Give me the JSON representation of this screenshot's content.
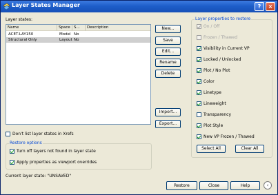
{
  "window": {
    "title": "Layer States Manager",
    "help_glyph": "?",
    "close_glyph": "×"
  },
  "layer_states": {
    "label": "Layer states:",
    "columns": [
      "Name",
      "Space",
      "S...",
      "Description"
    ],
    "rows": [
      {
        "name": "ACET-LAY150",
        "space": "Model",
        "same": "No",
        "description": ""
      },
      {
        "name": "Structural Only",
        "space": "Layout",
        "same": "No",
        "description": ""
      }
    ]
  },
  "buttons": {
    "new": "New...",
    "save": "Save",
    "edit": "Edit...",
    "rename": "Rename",
    "delete": "Delete",
    "import": "Import...",
    "export": "Export..."
  },
  "dont_list_xrefs": {
    "label": "Don't list layer states in Xrefs",
    "checked": false
  },
  "restore_options": {
    "title": "Restore options",
    "items": [
      {
        "label": "Turn off layers not found in layer state",
        "checked": true
      },
      {
        "label": "Apply properties as viewport overrides",
        "checked": true
      }
    ]
  },
  "properties": {
    "title": "Layer properties to restore",
    "items": [
      {
        "label": "On / Off",
        "checked": true,
        "enabled": false
      },
      {
        "label": "Frozen / Thawed",
        "checked": false,
        "enabled": false
      },
      {
        "label": "Visibility in Current VP",
        "checked": true,
        "enabled": true
      },
      {
        "label": "Locked / Unlocked",
        "checked": true,
        "enabled": true
      },
      {
        "label": "Plot / No Plot",
        "checked": true,
        "enabled": true
      },
      {
        "label": "Color",
        "checked": true,
        "enabled": true
      },
      {
        "label": "Linetype",
        "checked": true,
        "enabled": true
      },
      {
        "label": "Lineweight",
        "checked": true,
        "enabled": true
      },
      {
        "label": "Transparency",
        "checked": false,
        "enabled": true
      },
      {
        "label": "Plot Style",
        "checked": true,
        "enabled": true
      },
      {
        "label": "New VP Frozen / Thawed",
        "checked": true,
        "enabled": true
      }
    ],
    "select_all": "Select All",
    "clear_all": "Clear All"
  },
  "current_state": "Current layer state: \"UNSAVED\"",
  "footer": {
    "restore": "Restore",
    "close": "Close",
    "help": "Help",
    "expand_glyph": "‹"
  }
}
